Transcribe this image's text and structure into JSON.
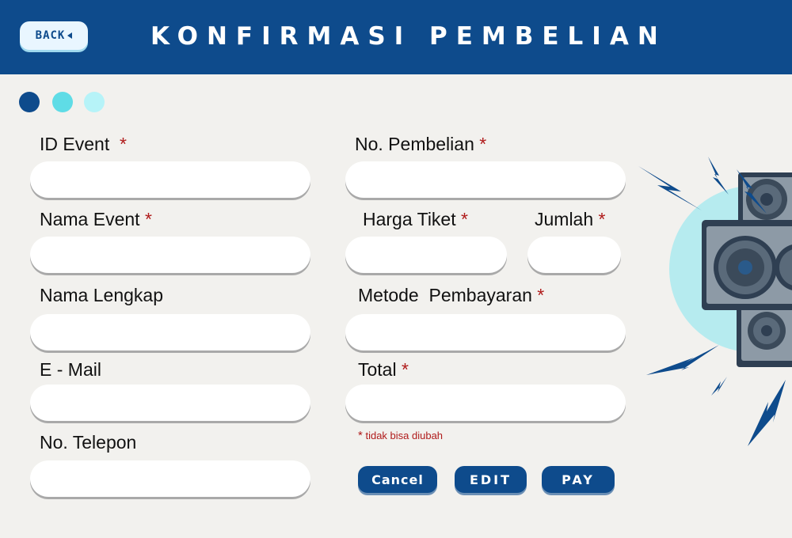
{
  "header": {
    "back_label": "BACK",
    "title": "KONFIRMASI PEMBELIAN"
  },
  "steps": [
    "step-1",
    "step-2",
    "step-3"
  ],
  "form_left": {
    "id_event_label": "ID Event",
    "nama_event_label": "Nama Event",
    "nama_lengkap_label": "Nama Lengkap",
    "email_label": "E - Mail",
    "telepon_label": "No. Telepon"
  },
  "form_right": {
    "no_pembelian_label": "No. Pembelian",
    "harga_tiket_label": "Harga Tiket",
    "jumlah_label": "Jumlah",
    "metode_label": "Metode  Pembayaran",
    "total_label": "Total"
  },
  "required_marker": "*",
  "note": {
    "marker": "*",
    "text": "tidak bisa diubah"
  },
  "buttons": {
    "cancel": "Cancel",
    "edit": "EDIT",
    "pay": "PAY"
  },
  "colors": {
    "primary": "#0e4b8c",
    "accent": "#5fdce6",
    "accent_light": "#b6f3f8",
    "required": "#b01b1b",
    "background": "#f2f1ee"
  },
  "icons": [
    "back-arrow-icon",
    "speaker-illustration",
    "lightning-icon"
  ]
}
